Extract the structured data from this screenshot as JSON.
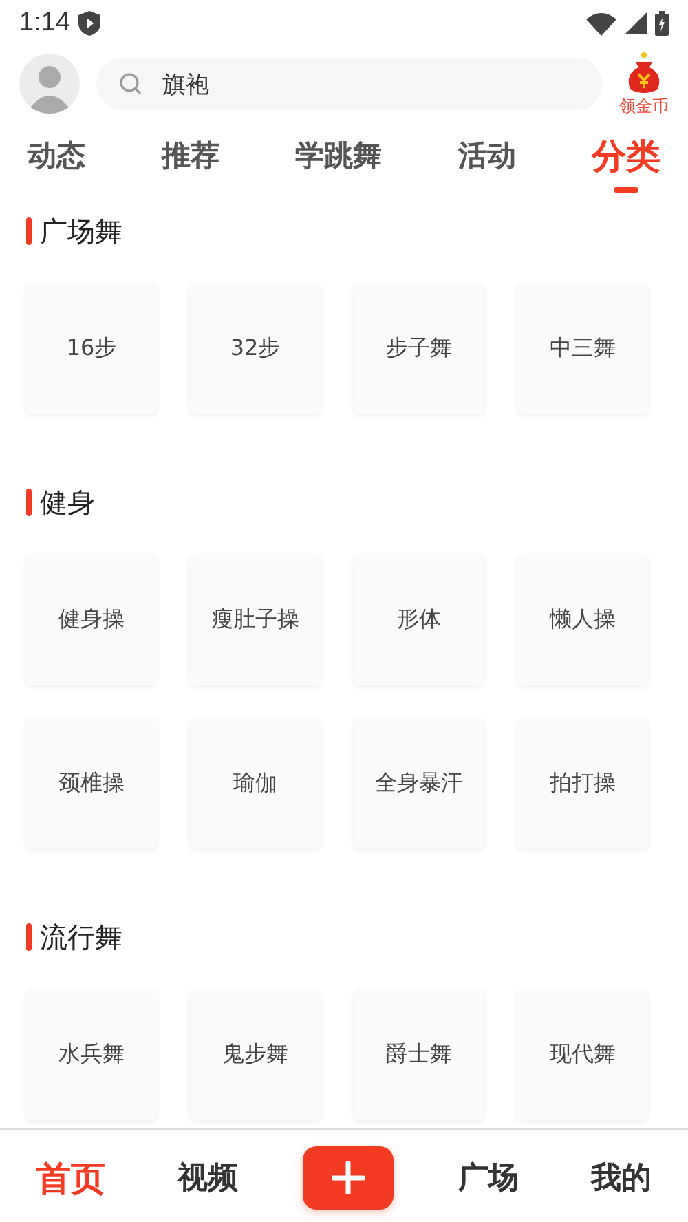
{
  "status_bar": {
    "time": "1:14"
  },
  "header": {
    "search": {
      "value": "旗袍"
    },
    "reward": {
      "label": "领金币"
    }
  },
  "tabs": [
    {
      "label": "动态",
      "selected": false
    },
    {
      "label": "推荐",
      "selected": false
    },
    {
      "label": "学跳舞",
      "selected": false
    },
    {
      "label": "活动",
      "selected": false
    },
    {
      "label": "分类",
      "selected": true
    }
  ],
  "sections": [
    {
      "title": "广场舞",
      "items": [
        "16步",
        "32步",
        "步子舞",
        "中三舞"
      ]
    },
    {
      "title": "健身",
      "items": [
        "健身操",
        "瘦肚子操",
        "形体",
        "懒人操",
        "颈椎操",
        "瑜伽",
        "全身暴汗",
        "拍打操"
      ]
    },
    {
      "title": "流行舞",
      "items": [
        "水兵舞",
        "鬼步舞",
        "爵士舞",
        "现代舞"
      ]
    }
  ],
  "bottom_nav": [
    {
      "kind": "tab",
      "label": "首页",
      "selected": true
    },
    {
      "kind": "tab",
      "label": "视频",
      "selected": false
    },
    {
      "kind": "add"
    },
    {
      "kind": "tab",
      "label": "广场",
      "selected": false
    },
    {
      "kind": "tab",
      "label": "我的",
      "selected": false
    }
  ]
}
